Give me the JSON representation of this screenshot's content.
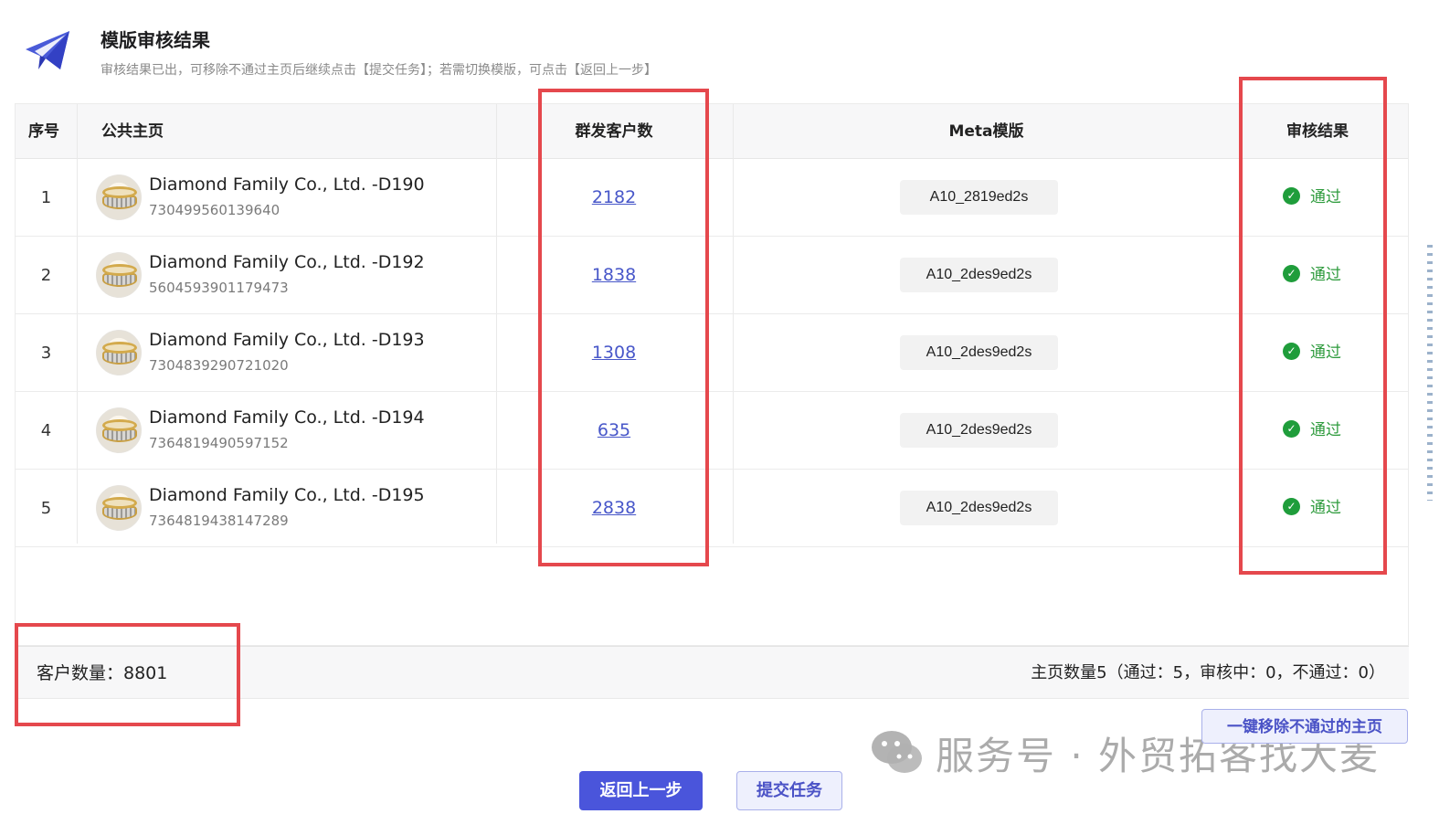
{
  "header": {
    "title": "模版审核结果",
    "subtitle": "审核结果已出，可移除不通过主页后继续点击【提交任务】；若需切换模版，可点击【返回上一步】"
  },
  "table": {
    "columns": [
      "序号",
      "公共主页",
      "群发客户数",
      "Meta模版",
      "审核结果"
    ],
    "rows": [
      {
        "no": "1",
        "name": "Diamond Family Co., Ltd. -D190",
        "id": "730499560139640",
        "count": "2182",
        "template": "A10_2819ed2s",
        "status": "通过"
      },
      {
        "no": "2",
        "name": "Diamond Family Co., Ltd. -D192",
        "id": "5604593901179473",
        "count": "1838",
        "template": "A10_2des9ed2s",
        "status": "通过"
      },
      {
        "no": "3",
        "name": "Diamond Family Co., Ltd. -D193",
        "id": "7304839290721020",
        "count": "1308",
        "template": "A10_2des9ed2s",
        "status": "通过"
      },
      {
        "no": "4",
        "name": "Diamond Family Co., Ltd. -D194",
        "id": "7364819490597152",
        "count": "635",
        "template": "A10_2des9ed2s",
        "status": "通过"
      },
      {
        "no": "5",
        "name": "Diamond Family Co., Ltd. -D195",
        "id": "7364819438147289",
        "count": "2838",
        "template": "A10_2des9ed2s",
        "status": "通过"
      }
    ]
  },
  "summary": {
    "customer_count": "客户数量：8801",
    "page_stats": "主页数量5（通过：5，审核中：0，不通过：0）"
  },
  "actions": {
    "remove_failed": "一键移除不通过的主页",
    "back": "返回上一步",
    "submit": "提交任务"
  },
  "watermark": {
    "text": "服务号 · 外贸拓客找大麦",
    "icon": "wechat-icon"
  },
  "colors": {
    "accent": "#4a55db",
    "link": "#4857c9",
    "pass": "#1f9d3b",
    "highlight": "#e5484d"
  }
}
